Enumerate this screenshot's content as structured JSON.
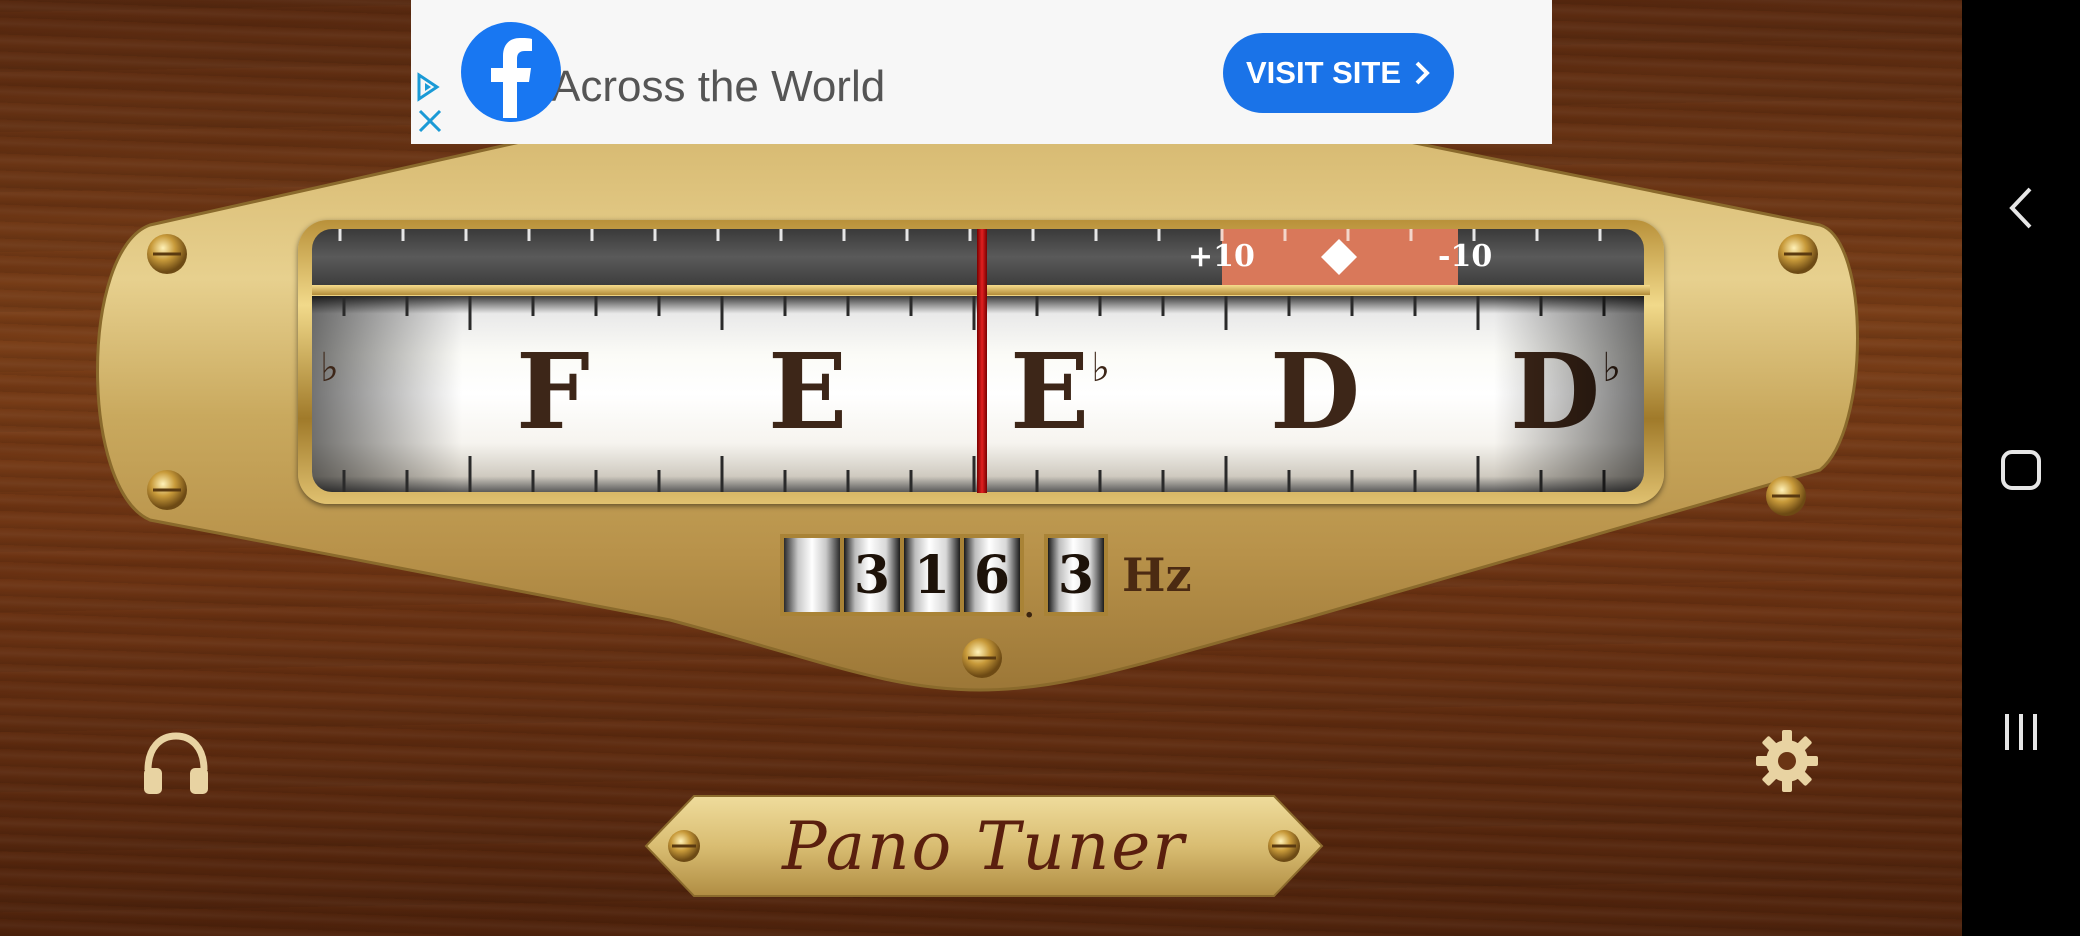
{
  "ad": {
    "headline": "Across the World",
    "button_label": "VISIT SITE",
    "choice_icon": "adchoices-icon",
    "close_icon": "close-icon",
    "logo_icon": "facebook-icon",
    "button_color": "#1a73e8"
  },
  "cents_scale": {
    "left_label": "+10",
    "right_label": "-10",
    "zone_color": "#d9785a"
  },
  "note_strip": {
    "notes": [
      {
        "letter": "",
        "accidental": "♭"
      },
      {
        "letter": "F",
        "accidental": ""
      },
      {
        "letter": "E",
        "accidental": ""
      },
      {
        "letter": "E",
        "accidental": "♭"
      },
      {
        "letter": "D",
        "accidental": ""
      },
      {
        "letter": "D",
        "accidental": "♭"
      }
    ]
  },
  "frequency": {
    "digits": [
      "",
      "3",
      "1",
      "6"
    ],
    "decimal": "3",
    "separator": ".",
    "unit": "Hz"
  },
  "controls": {
    "headphones_icon": "headphones-icon",
    "settings_icon": "gear-icon"
  },
  "app": {
    "title": "Pano Tuner"
  },
  "navbar": {
    "back_icon": "back-icon",
    "home_icon": "home-icon",
    "recents_icon": "recents-icon"
  }
}
